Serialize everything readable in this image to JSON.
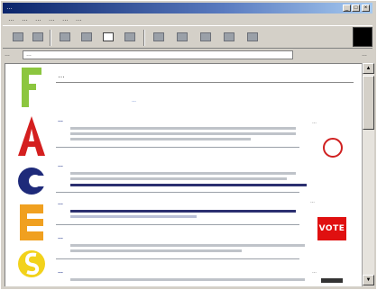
{
  "window": {
    "title": "…",
    "controls": [
      "_",
      "□",
      "×"
    ]
  },
  "menubar": {
    "items": [
      "…",
      "…",
      "…",
      "…",
      "…",
      "…"
    ]
  },
  "toolbar": {
    "buttons": [
      {
        "icon": "back-icon"
      },
      {
        "icon": "forward-icon"
      },
      {
        "icon": "stop-icon"
      },
      {
        "icon": "refresh-icon"
      },
      {
        "icon": "home-icon"
      },
      {
        "icon": "search-icon"
      },
      {
        "icon": "favorites-icon"
      },
      {
        "icon": "history-icon"
      },
      {
        "icon": "mail-icon"
      },
      {
        "icon": "print-icon"
      },
      {
        "icon": "edit-icon"
      }
    ]
  },
  "address": {
    "label": "…",
    "value": "…",
    "links_label": "…"
  },
  "page": {
    "header_title": "…",
    "header_link": "…",
    "letters": [
      {
        "char": "F",
        "color": "#8cc63f"
      },
      {
        "char": "A",
        "color": "#d41f1f"
      },
      {
        "char": "C",
        "color": "#1e2a7a"
      },
      {
        "char": "E",
        "color": "#f0a020"
      },
      {
        "char": "S",
        "color": "#f2d21b"
      }
    ],
    "entries": [
      {
        "title": "…"
      },
      {
        "title": "…"
      },
      {
        "title": "…"
      },
      {
        "title": "…"
      },
      {
        "title": "…"
      }
    ],
    "sidebar": {
      "label_top": "…",
      "label_middle": "…",
      "badge_vote": "VOTE",
      "label_bottom": "…"
    }
  }
}
